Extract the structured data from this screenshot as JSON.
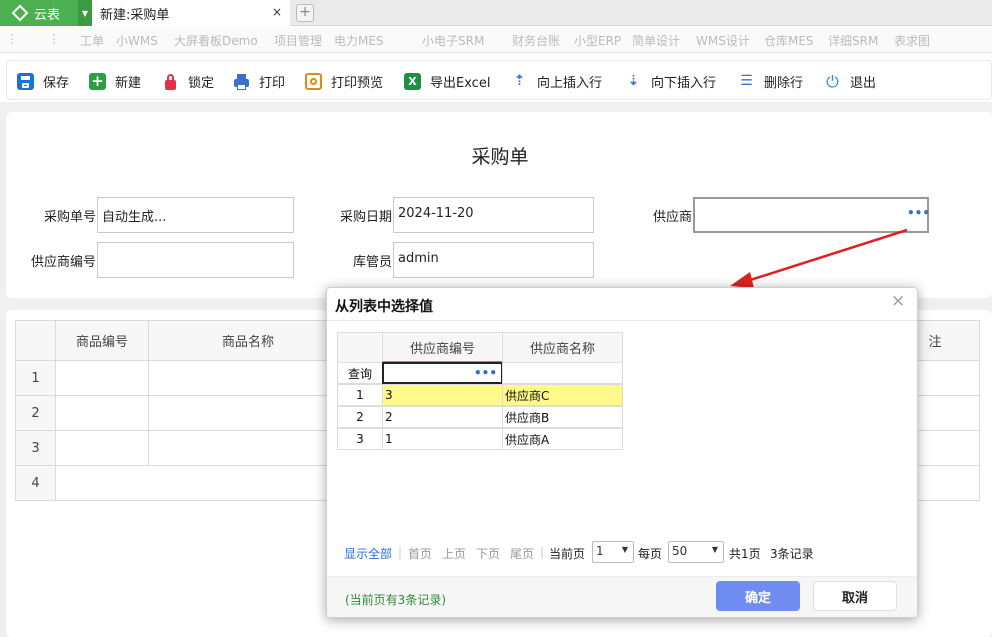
{
  "app": {
    "brand": "云表",
    "tab_title": "新建:采购单",
    "tab_close": "×",
    "tab_add": "+"
  },
  "menu": [
    "工单",
    "小WMS",
    "大屏看板Demo",
    "项目管理",
    "电力MES",
    "小电子SRM",
    "财务台账",
    "小型ERP",
    "简单设计",
    "WMS设计",
    "仓库MES",
    "详细SRM",
    "表求图"
  ],
  "toolbar": [
    {
      "label": "保存",
      "icon": "save-icon",
      "color": "#1a73d9"
    },
    {
      "label": "新建",
      "icon": "add-icon",
      "color": "#2e9e43"
    },
    {
      "label": "锁定",
      "icon": "lock-icon",
      "color": "#e0304a"
    },
    {
      "label": "打印",
      "icon": "print-icon",
      "color": "#3b6fc9"
    },
    {
      "label": "打印预览",
      "icon": "print-preview-icon",
      "color": "#e08a1a"
    },
    {
      "label": "导出Excel",
      "icon": "excel-icon",
      "color": "#1f8f46"
    },
    {
      "label": "向上插入行",
      "icon": "insert-row-up-icon",
      "color": "#3b6fc9"
    },
    {
      "label": "向下插入行",
      "icon": "insert-row-down-icon",
      "color": "#3b6fc9"
    },
    {
      "label": "删除行",
      "icon": "delete-row-icon",
      "color": "#3b6fc9"
    },
    {
      "label": "退出",
      "icon": "power-icon",
      "color": "#1a8fd9"
    }
  ],
  "form": {
    "title": "采购单",
    "order_no": {
      "label": "采购单号",
      "value": "自动生成..."
    },
    "order_date": {
      "label": "采购日期",
      "value": "2024-11-20"
    },
    "supplier": {
      "label": "供应商",
      "value": "",
      "picker": "•••"
    },
    "supplier_code": {
      "label": "供应商编号",
      "value": ""
    },
    "keeper": {
      "label": "库管员",
      "value": "admin"
    }
  },
  "grid": {
    "columns": [
      "商品编号",
      "商品名称",
      "注"
    ],
    "rows": [
      "1",
      "2",
      "3",
      "4"
    ]
  },
  "dialog": {
    "title": "从列表中选择值",
    "close": "×",
    "columns": [
      "供应商编号",
      "供应商名称"
    ],
    "query_label": "查询",
    "query_picker": "•••",
    "rows": [
      {
        "idx": "1",
        "code": "3",
        "name": "供应商C",
        "selected": true
      },
      {
        "idx": "2",
        "code": "2",
        "name": "供应商B",
        "selected": false
      },
      {
        "idx": "3",
        "code": "1",
        "name": "供应商A",
        "selected": false
      }
    ],
    "pagination": {
      "show_all": "显示全部",
      "first": "首页",
      "prev": "上页",
      "next": "下页",
      "last": "尾页",
      "current_label": "当前页",
      "current": "1",
      "per_page_label": "每页",
      "per_page": "50",
      "total_pages": "共1页",
      "total_records": "3条记录"
    },
    "status": "(当前页有3条记录)",
    "ok": "确定",
    "cancel": "取消"
  },
  "colors": {
    "brand": "#4caf50",
    "selected_row": "#fff98c",
    "ok_button": "#6f8df0",
    "status_text": "#2e8b3a",
    "link": "#2a6fd6",
    "arrow": "#e02020"
  }
}
